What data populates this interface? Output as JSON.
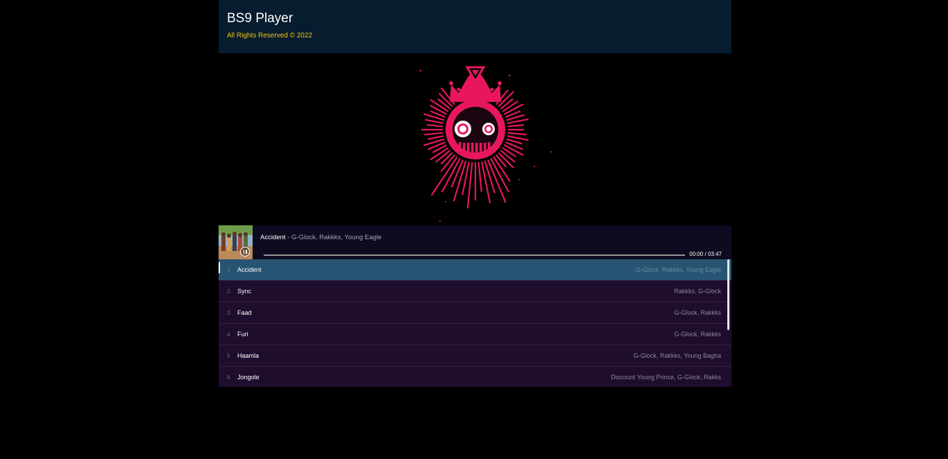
{
  "header": {
    "title": "BS9 Player",
    "copyright": "All Rights Reserved © 2022"
  },
  "visualizer": {
    "logo_icon": "neon-crown-face-icon",
    "accent": "#e8175d"
  },
  "now_playing": {
    "title": "Accident",
    "separator": " - ",
    "artists": "G-Glock, Rakkks, Young Eagle",
    "time": "00:00 / 03:47",
    "progress": 0,
    "control_icon": "pause-icon"
  },
  "playlist": [
    {
      "num": "1",
      "title": "Accident",
      "artists": "G-Glock, Rakkks, Young Eagle",
      "active": true
    },
    {
      "num": "2",
      "title": "Sync",
      "artists": "Rakkks, G-Glock",
      "active": false
    },
    {
      "num": "3",
      "title": "Faad",
      "artists": "G-Glock, Rakkks",
      "active": false
    },
    {
      "num": "4",
      "title": "Furi",
      "artists": "G-Glock, Rakkks",
      "active": false
    },
    {
      "num": "5",
      "title": "Haamla",
      "artists": "G-Glock, Rakkks, Young Bagha",
      "active": false
    },
    {
      "num": "6",
      "title": "Jongole",
      "artists": "Discount Young Prince, G-Glock, Rakks",
      "active": false
    }
  ],
  "colors": {
    "header_bg": "#071c2e",
    "copyright": "#f1c40f",
    "active_row": "#285473",
    "row_bg": "#1f0d2e"
  }
}
